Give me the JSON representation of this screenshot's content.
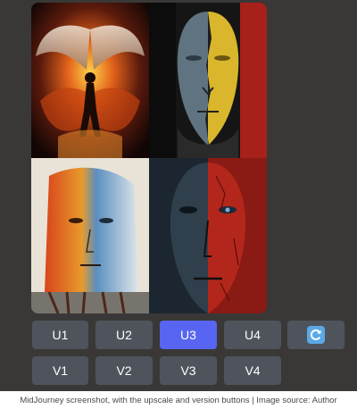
{
  "image_grid": {
    "quadrants": [
      {
        "subject": "fire-phoenix-figure"
      },
      {
        "subject": "split-face-blue-yellow-red"
      },
      {
        "subject": "painted-face-orange-blue"
      },
      {
        "subject": "split-face-dark-red"
      }
    ]
  },
  "upscale_buttons": [
    {
      "label": "U1",
      "active": false
    },
    {
      "label": "U2",
      "active": false
    },
    {
      "label": "U3",
      "active": true
    },
    {
      "label": "U4",
      "active": false
    }
  ],
  "reroll_button": {
    "icon": "refresh-icon",
    "color": "#5865f2"
  },
  "variation_buttons": [
    {
      "label": "V1"
    },
    {
      "label": "V2"
    },
    {
      "label": "V3"
    },
    {
      "label": "V4"
    }
  ],
  "caption": "MidJourney screenshot, with the upscale and version buttons | Image source: Author",
  "colors": {
    "panel_bg": "#3a3836",
    "button_bg": "#4f545c",
    "button_active": "#5865f2",
    "button_text": "#ffffff"
  }
}
